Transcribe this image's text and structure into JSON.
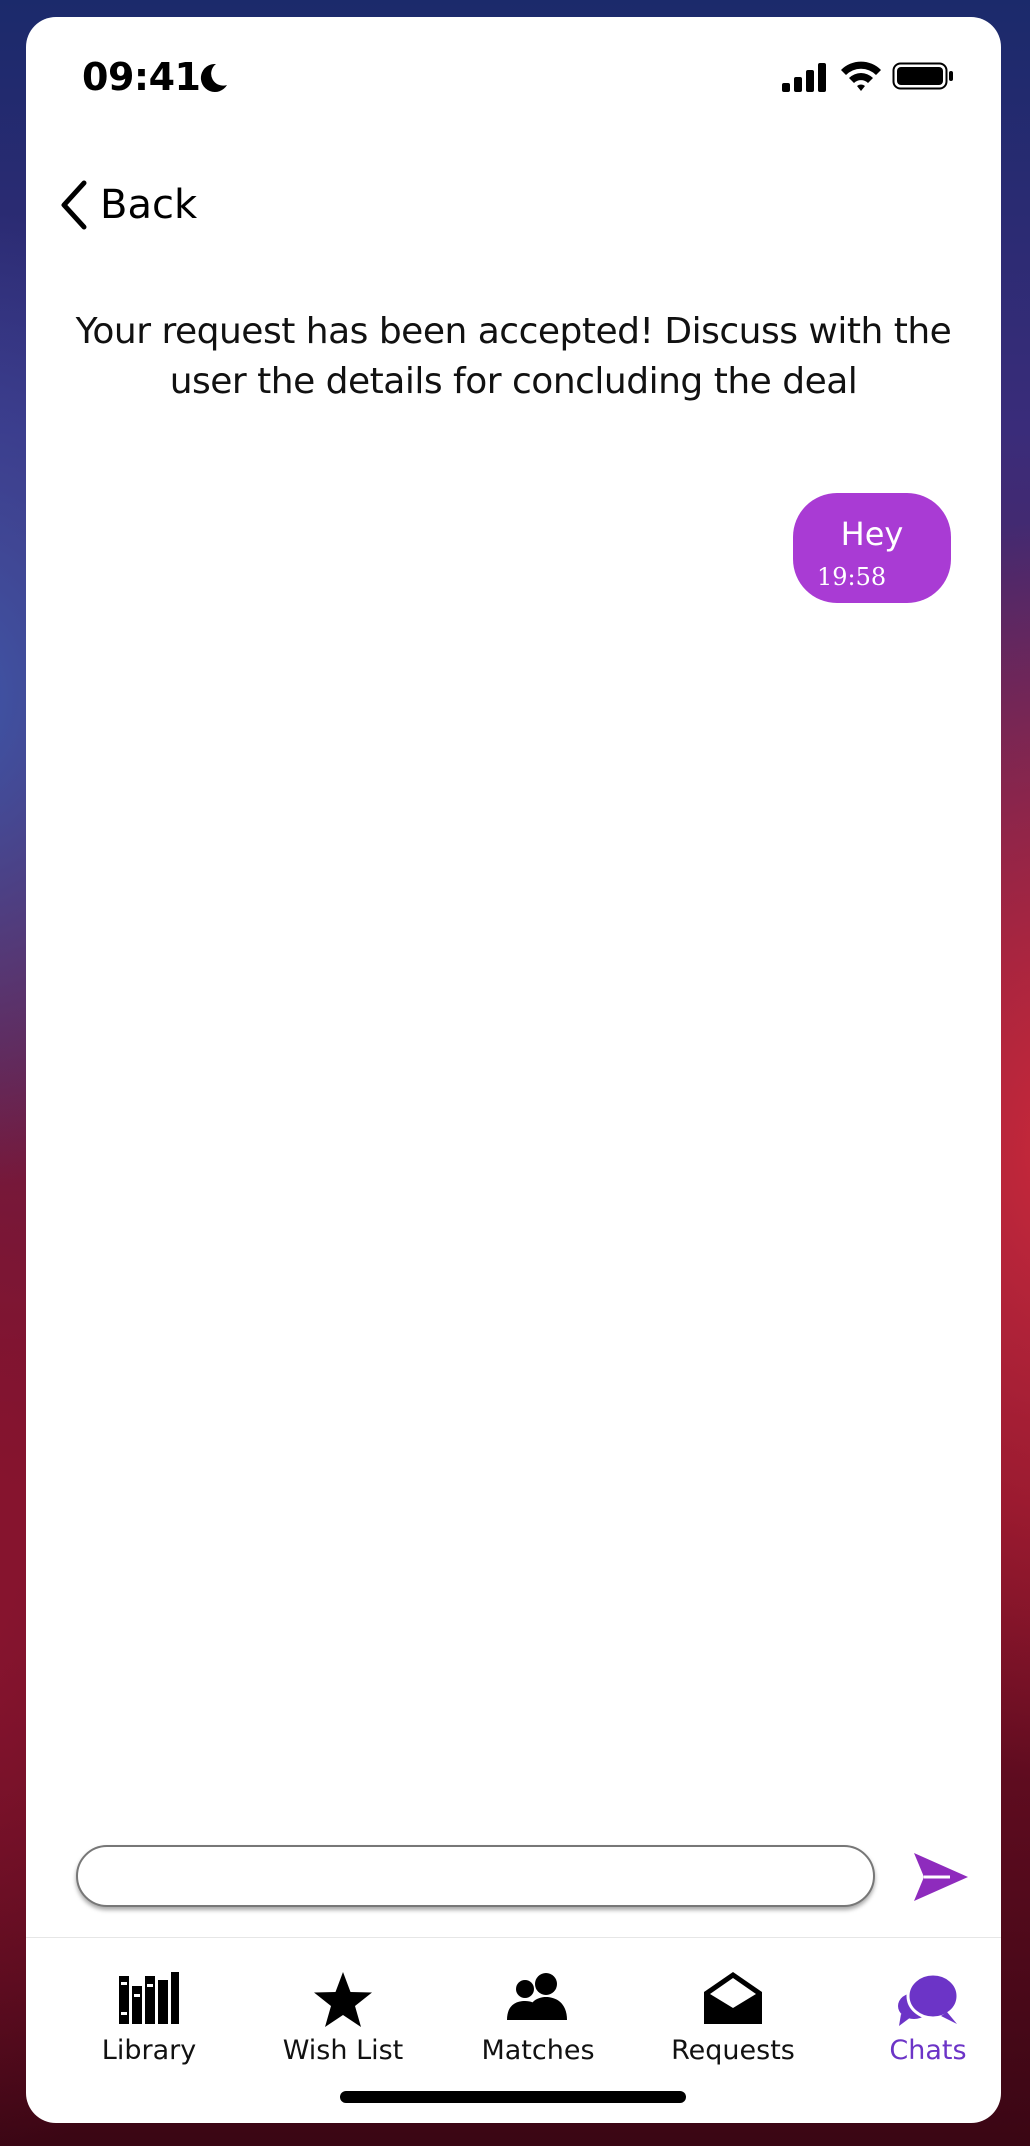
{
  "status_bar": {
    "time": "09:41",
    "icons": [
      "moon-icon",
      "signal-icon",
      "wifi-icon",
      "battery-icon"
    ]
  },
  "nav": {
    "back_label": "Back"
  },
  "chat": {
    "info_message": "Your request has been accepted! Discuss with the user the details for concluding the deal",
    "messages": [
      {
        "text": "Hey",
        "time": "19:58",
        "sender": "self"
      }
    ]
  },
  "composer": {
    "value": "",
    "placeholder": "",
    "send_icon": "send-icon"
  },
  "tabbar": {
    "tabs": [
      {
        "label": "Library",
        "icon": "library-icon",
        "active": false
      },
      {
        "label": "Wish List",
        "icon": "star-icon",
        "active": false
      },
      {
        "label": "Matches",
        "icon": "users-icon",
        "active": false
      },
      {
        "label": "Requests",
        "icon": "envelope-open-icon",
        "active": false
      },
      {
        "label": "Chats",
        "icon": "chat-bubbles-icon",
        "active": true
      }
    ]
  },
  "colors": {
    "bubble": "#a93bd4",
    "accent": "#6c34c7",
    "send": "#8e2bbd"
  }
}
